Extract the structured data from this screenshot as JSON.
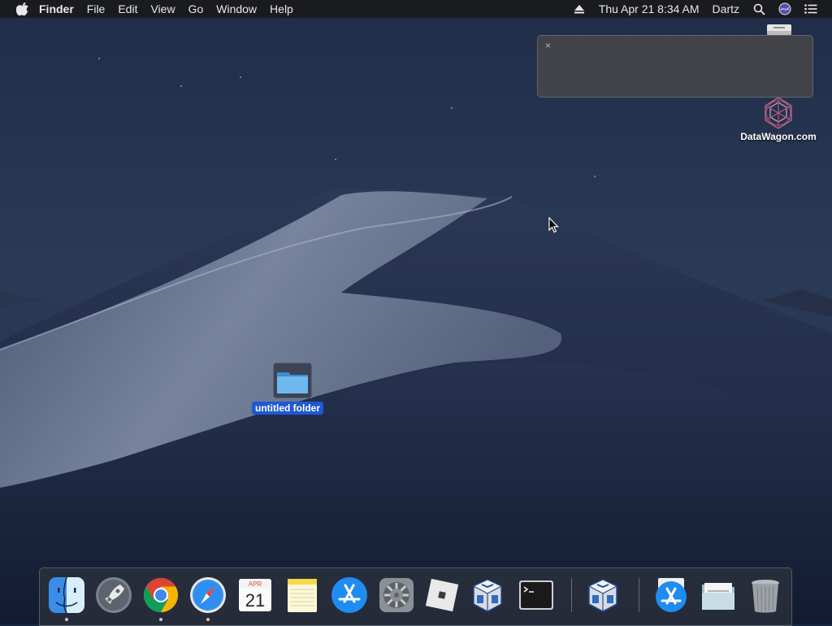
{
  "menubar": {
    "app_name": "Finder",
    "menus": [
      "File",
      "Edit",
      "View",
      "Go",
      "Window",
      "Help"
    ],
    "clock": "Thu Apr 21  8:34 AM",
    "user": "Dartz"
  },
  "notification": {
    "close_glyph": "×"
  },
  "desktop": {
    "items": [
      {
        "label": "DataWagon.com",
        "icon": "datawagon-logo-icon"
      },
      {
        "label": "untitled folder",
        "icon": "folder-icon",
        "selected": true
      },
      {
        "label": "",
        "icon": "external-drive-icon"
      }
    ]
  },
  "dock": {
    "items": [
      {
        "name": "Finder",
        "icon": "finder-icon",
        "running": true
      },
      {
        "name": "Launchpad",
        "icon": "launchpad-icon",
        "running": false
      },
      {
        "name": "Google Chrome",
        "icon": "chrome-icon",
        "running": true
      },
      {
        "name": "Safari",
        "icon": "safari-icon",
        "running": true
      },
      {
        "name": "Calendar",
        "icon": "calendar-icon",
        "running": false,
        "month": "APR",
        "day": "21"
      },
      {
        "name": "Notes",
        "icon": "notes-icon",
        "running": false
      },
      {
        "name": "App Store",
        "icon": "app-store-icon",
        "running": false
      },
      {
        "name": "System Preferences",
        "icon": "system-preferences-icon",
        "running": false
      },
      {
        "name": "Roblox",
        "icon": "roblox-icon",
        "running": false
      },
      {
        "name": "VirtualBox",
        "icon": "virtualbox-icon",
        "running": false
      },
      {
        "name": "Terminal",
        "icon": "terminal-icon",
        "running": false
      },
      {
        "name": "VirtualBox",
        "icon": "virtualbox-icon",
        "running": false
      },
      {
        "name": "Downloads",
        "icon": "app-store-stack-icon",
        "running": false
      },
      {
        "name": "Documents",
        "icon": "document-stack-icon",
        "running": false
      },
      {
        "name": "Trash",
        "icon": "trash-icon",
        "running": false
      }
    ]
  },
  "colors": {
    "selection": "#1e58d6",
    "menubar": "#1a1a1c",
    "sky": "#1c2a45"
  }
}
